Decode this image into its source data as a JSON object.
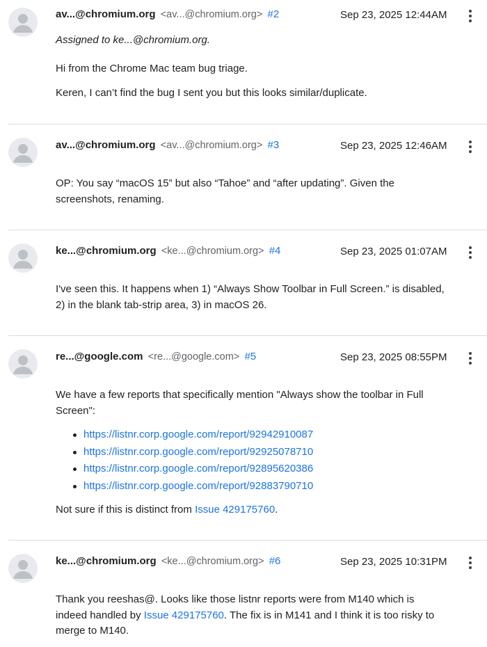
{
  "comments": [
    {
      "author": "av...@chromium.org",
      "email": "<av...@chromium.org>",
      "number": "#2",
      "timestamp": "Sep 23, 2025 12:44AM",
      "assigned": "Assigned to ke...@chromium.org.",
      "p1": "Hi from the Chrome Mac team bug triage.",
      "p2": "Keren, I can’t find the bug I sent you but this looks similar/duplicate."
    },
    {
      "author": "av...@chromium.org",
      "email": "<av...@chromium.org>",
      "number": "#3",
      "timestamp": "Sep 23, 2025 12:46AM",
      "p1_line1": "OP: You say “macOS 15” but also “Tahoe” and “after updating”. Given the",
      "p1_line2": "screenshots, renaming."
    },
    {
      "author": "ke...@chromium.org",
      "email": "<ke...@chromium.org>",
      "number": "#4",
      "timestamp": "Sep 23, 2025 01:07AM",
      "p1_line1": "I've seen this. It happens when 1) “Always Show Toolbar in Full Screen.” is disabled,",
      "p1_line2": "2) in the blank tab-strip area, 3) in macOS 26."
    },
    {
      "author": "re...@google.com",
      "email": "<re...@google.com>",
      "number": "#5",
      "timestamp": "Sep 23, 2025 08:55PM",
      "p1_line1": "We have a few reports that specifically mention \"Always show the toolbar in Full",
      "p1_line2": "Screen\":",
      "links": [
        "https://listnr.corp.google.com/report/92942910087",
        "https://listnr.corp.google.com/report/92925078710",
        "https://listnr.corp.google.com/report/92895620386",
        "https://listnr.corp.google.com/report/92883790710"
      ],
      "p2_prefix": "Not sure if this is distinct from ",
      "p2_link": "Issue 429175760",
      "p2_suffix": "."
    },
    {
      "author": "ke...@chromium.org",
      "email": "<ke...@chromium.org>",
      "number": "#6",
      "timestamp": "Sep 23, 2025 10:31PM",
      "line1": "Thank you reeshas@. Looks like those listnr reports were from M140 which is",
      "line2_prefix": "indeed handled by ",
      "line2_link": "Issue 429175760",
      "line2_suffix": ". The fix is in M141 and I think it is too risky to",
      "line3": "merge to M140."
    }
  ],
  "icons": {
    "avatar": "person-avatar-icon",
    "menu": "more-vert-icon"
  },
  "colors": {
    "link": "#1a73e8",
    "text": "#202124",
    "secondary": "#5f6368",
    "divider": "#dadce0",
    "avatar_bg": "#e8eaed",
    "avatar_fg": "#bdc1c6"
  }
}
